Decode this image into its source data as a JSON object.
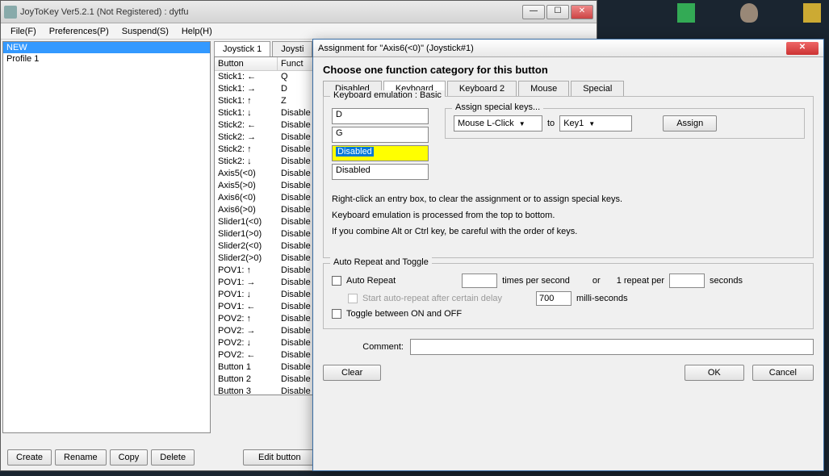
{
  "mainWindow": {
    "title": "JoyToKey Ver5.2.1 (Not Registered) : dytfu",
    "menus": [
      "File(F)",
      "Preferences(P)",
      "Suspend(S)",
      "Help(H)"
    ],
    "profiles": [
      {
        "name": "NEW",
        "selected": true
      },
      {
        "name": "Profile 1",
        "selected": false
      }
    ],
    "tabs": [
      "Joystick 1",
      "Joysti"
    ],
    "table": {
      "headers": [
        "Button",
        "Funct"
      ],
      "rows": [
        [
          "Stick1: ←",
          "Q"
        ],
        [
          "Stick1: →",
          "D"
        ],
        [
          "Stick1: ↑",
          "Z"
        ],
        [
          "Stick1: ↓",
          "Disable"
        ],
        [
          "Stick2: ←",
          "Disable"
        ],
        [
          "Stick2: →",
          "Disable"
        ],
        [
          "Stick2: ↑",
          "Disable"
        ],
        [
          "Stick2: ↓",
          "Disable"
        ],
        [
          "Axis5(<0)",
          "Disable"
        ],
        [
          "Axis5(>0)",
          "Disable"
        ],
        [
          "Axis6(<0)",
          "Disable"
        ],
        [
          "Axis6(>0)",
          "Disable"
        ],
        [
          "Slider1(<0)",
          "Disable"
        ],
        [
          "Slider1(>0)",
          "Disable"
        ],
        [
          "Slider2(<0)",
          "Disable"
        ],
        [
          "Slider2(>0)",
          "Disable"
        ],
        [
          "POV1: ↑",
          "Disable"
        ],
        [
          "POV1: →",
          "Disable"
        ],
        [
          "POV1: ↓",
          "Disable"
        ],
        [
          "POV1: ←",
          "Disable"
        ],
        [
          "POV2: ↑",
          "Disable"
        ],
        [
          "POV2: →",
          "Disable"
        ],
        [
          "POV2: ↓",
          "Disable"
        ],
        [
          "POV2: ←",
          "Disable"
        ],
        [
          "Button 1",
          "Disable"
        ],
        [
          "Button 2",
          "Disable"
        ],
        [
          "Button 3",
          "Disable"
        ]
      ]
    },
    "buttons": {
      "create": "Create",
      "rename": "Rename",
      "copy": "Copy",
      "delete": "Delete",
      "edit": "Edit button"
    }
  },
  "dialog": {
    "title": "Assignment for \"Axis6(<0)\" (Joystick#1)",
    "heading": "Choose one function category for this button",
    "tabs": [
      "Disabled",
      "Keyboard",
      "Keyboard 2",
      "Mouse",
      "Special"
    ],
    "activeTab": 1,
    "kbLegend": "Keyboard emulation : Basic",
    "kbInputs": [
      "D",
      "G",
      "Disabled",
      "Disabled"
    ],
    "assign": {
      "legend": "Assign special keys...",
      "fromSel": "Mouse L-Click",
      "to": "to",
      "toSel": "Key1",
      "btn": "Assign"
    },
    "help1": "Right-click an entry box, to clear the assignment or to assign special keys.",
    "help2": "Keyboard emulation is processed from the top to bottom.",
    "help3": "If you combine Alt or Ctrl key, be careful with the order of keys.",
    "auto": {
      "legend": "Auto Repeat and Toggle",
      "autoRepeat": "Auto Repeat",
      "timesPer": "times per second",
      "or": "or",
      "repeatPer": "1 repeat per",
      "seconds": "seconds",
      "startDelay": "Start auto-repeat after certain delay",
      "delayVal": "700",
      "ms": "milli-seconds",
      "toggle": "Toggle between ON and OFF"
    },
    "commentLabel": "Comment:",
    "btns": {
      "clear": "Clear",
      "ok": "OK",
      "cancel": "Cancel"
    }
  }
}
